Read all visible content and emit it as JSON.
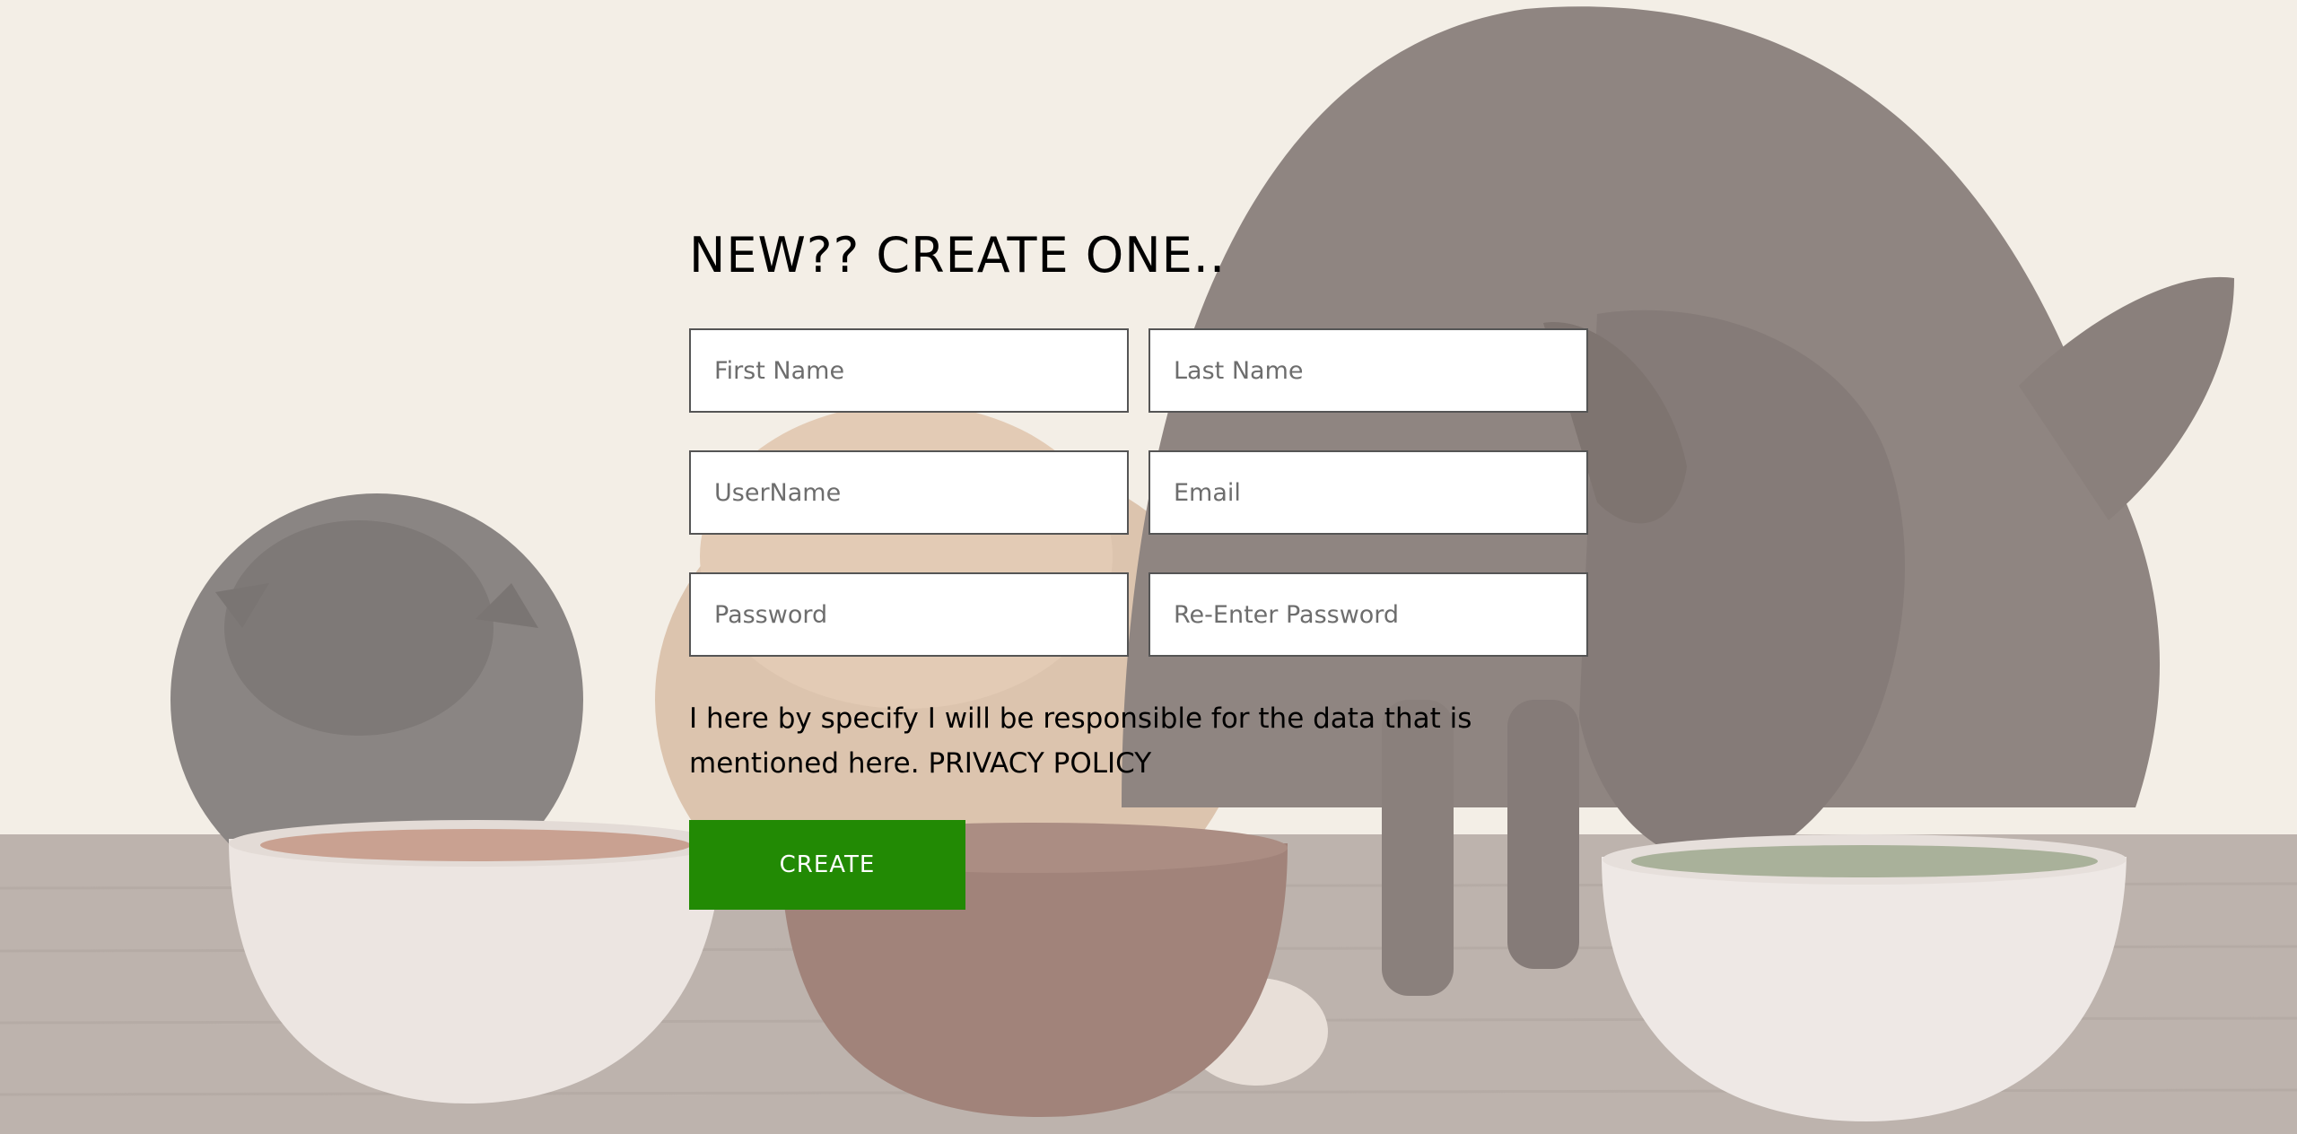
{
  "form": {
    "title": "NEW?? CREATE ONE..",
    "fields": {
      "first_name": "First Name",
      "last_name": "Last Name",
      "username": "UserName",
      "email": "Email",
      "password": "Password",
      "reenter_password": "Re-Enter Password"
    },
    "terms_text": "I here by specify I will be responsible for the data that is mentioned here.",
    "privacy_link": "PRIVACY POLICY",
    "create_label": "CREATE"
  },
  "colors": {
    "button": "#228a04",
    "background": "#f3eee6"
  }
}
